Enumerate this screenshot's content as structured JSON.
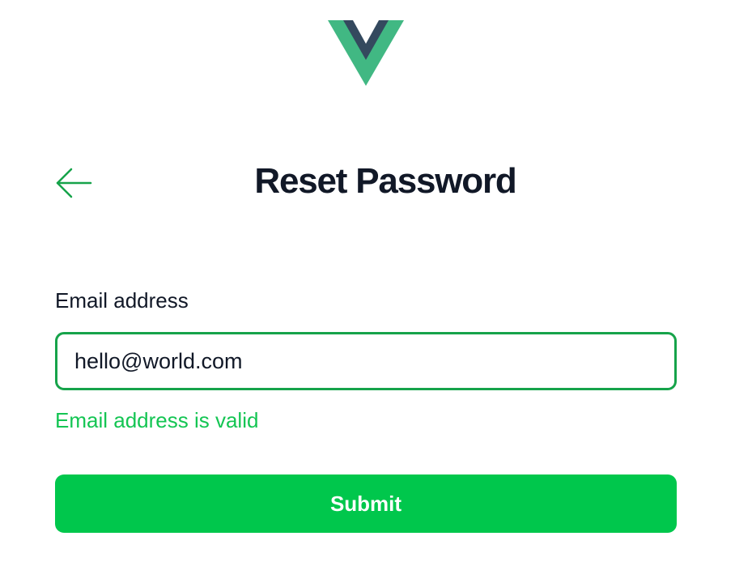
{
  "logo": {
    "icon": "vue-logo-icon",
    "colors": {
      "outer": "#41b883",
      "inner": "#34495e"
    }
  },
  "header": {
    "back_icon": "arrow-left-icon",
    "title": "Reset Password"
  },
  "form": {
    "email_label": "Email address",
    "email_value": "hello@world.com",
    "validation_message": "Email address is valid",
    "submit_label": "Submit"
  },
  "colors": {
    "accent": "#00c74c",
    "valid_border": "#16a34a",
    "valid_text": "#14c553",
    "text": "#111827"
  }
}
